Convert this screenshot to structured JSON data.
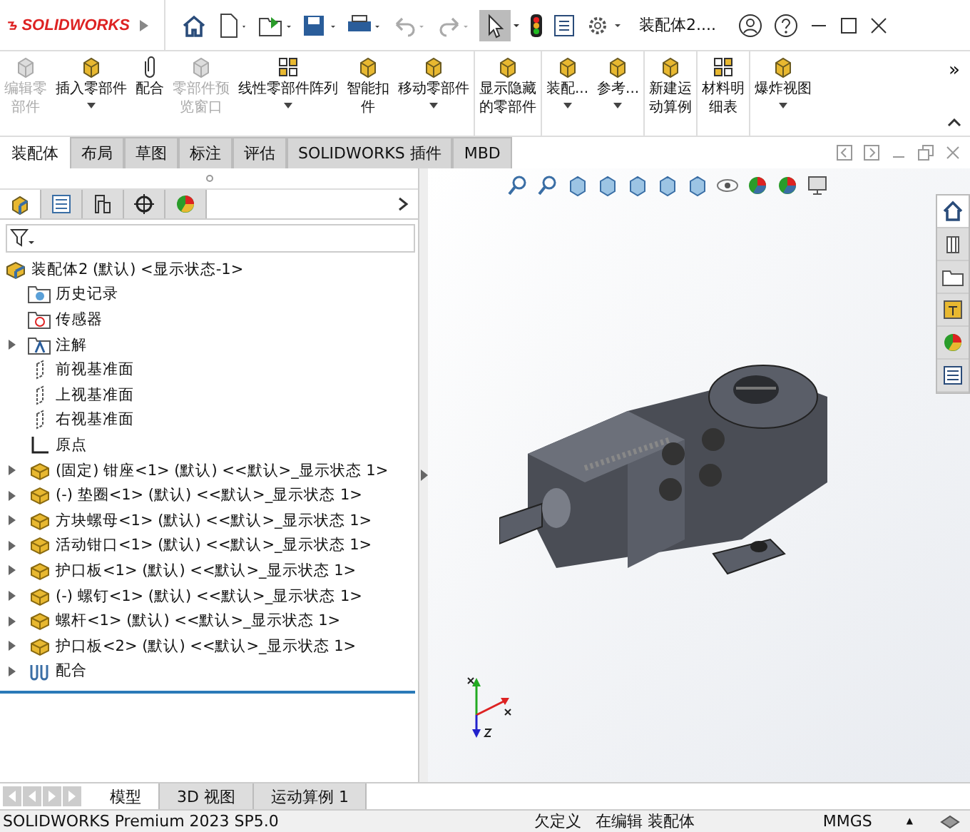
{
  "title_bar": {
    "brand": "SOLIDWORKS",
    "document_title": "装配体2...."
  },
  "ribbon": {
    "groups": [
      [
        {
          "label": "编辑零部件",
          "disabled": true,
          "dropdown": false
        },
        {
          "label": "插入零部件",
          "disabled": false,
          "dropdown": true
        },
        {
          "label": "配合",
          "disabled": false,
          "dropdown": false
        },
        {
          "label": "零部件预览窗口",
          "disabled": true,
          "dropdown": false
        },
        {
          "label": "线性零部件阵列",
          "disabled": false,
          "dropdown": true
        },
        {
          "label": "智能扣件",
          "disabled": false,
          "dropdown": false
        },
        {
          "label": "移动零部件",
          "disabled": false,
          "dropdown": true
        }
      ],
      [
        {
          "label": "显示隐藏的零部件",
          "disabled": false,
          "dropdown": false
        }
      ],
      [
        {
          "label": "装配...",
          "disabled": false,
          "dropdown": true
        },
        {
          "label": "参考...",
          "disabled": false,
          "dropdown": true
        }
      ],
      [
        {
          "label": "新建运动算例",
          "disabled": false,
          "dropdown": false
        }
      ],
      [
        {
          "label": "材料明细表",
          "disabled": false,
          "dropdown": false
        }
      ],
      [
        {
          "label": "爆炸视图",
          "disabled": false,
          "dropdown": true
        }
      ]
    ],
    "more": "»"
  },
  "tabs": [
    {
      "label": "装配体",
      "selected": true
    },
    {
      "label": "布局",
      "selected": false
    },
    {
      "label": "草图",
      "selected": false
    },
    {
      "label": "标注",
      "selected": false
    },
    {
      "label": "评估",
      "selected": false
    },
    {
      "label": "SOLIDWORKS 插件",
      "selected": false
    },
    {
      "label": "MBD",
      "selected": false
    }
  ],
  "panel_tabs": [
    {
      "selected": true
    },
    {
      "selected": false
    },
    {
      "selected": false
    },
    {
      "selected": false
    },
    {
      "selected": false
    }
  ],
  "tree": {
    "label": "装配体2 (默认) <显示状态-1>",
    "children": [
      {
        "kind": "history",
        "label": "历史记录",
        "expandable": false
      },
      {
        "kind": "sensor",
        "label": "传感器",
        "expandable": false
      },
      {
        "kind": "annotation",
        "label": "注解",
        "expandable": true
      },
      {
        "kind": "plane",
        "label": "前视基准面",
        "expandable": false
      },
      {
        "kind": "plane",
        "label": "上视基准面",
        "expandable": false
      },
      {
        "kind": "plane",
        "label": "右视基准面",
        "expandable": false
      },
      {
        "kind": "origin",
        "label": "原点",
        "expandable": false
      },
      {
        "kind": "part",
        "label": "(固定) 钳座<1> (默认) <<默认>_显示状态 1>",
        "expandable": true
      },
      {
        "kind": "part",
        "label": "(-) 垫圈<1> (默认) <<默认>_显示状态 1>",
        "expandable": true
      },
      {
        "kind": "part",
        "label": "方块螺母<1> (默认) <<默认>_显示状态 1>",
        "expandable": true
      },
      {
        "kind": "part",
        "label": "活动钳口<1> (默认) <<默认>_显示状态 1>",
        "expandable": true
      },
      {
        "kind": "part",
        "label": "护口板<1> (默认) <<默认>_显示状态 1>",
        "expandable": true
      },
      {
        "kind": "part",
        "label": "(-) 螺钉<1> (默认) <<默认>_显示状态 1>",
        "expandable": true
      },
      {
        "kind": "part",
        "label": "螺杆<1> (默认) <<默认>_显示状态 1>",
        "expandable": true
      },
      {
        "kind": "part",
        "label": "护口板<2> (默认) <<默认>_显示状态 1>",
        "expandable": true
      },
      {
        "kind": "mates",
        "label": "配合",
        "expandable": true
      }
    ]
  },
  "task_pane": [
    {
      "selected": true
    },
    {
      "selected": false
    },
    {
      "selected": false
    },
    {
      "selected": false
    },
    {
      "selected": false
    },
    {
      "selected": false
    }
  ],
  "bottom_tabs": [
    {
      "label": "模型",
      "selected": true
    },
    {
      "label": "3D 视图",
      "selected": false
    },
    {
      "label": "运动算例 1",
      "selected": false
    }
  ],
  "status_bar": {
    "product": "SOLIDWORKS Premium 2023 SP5.0",
    "state": "欠定义",
    "mode": "在编辑 装配体",
    "units": "MMGS",
    "units_caret": "▲"
  }
}
